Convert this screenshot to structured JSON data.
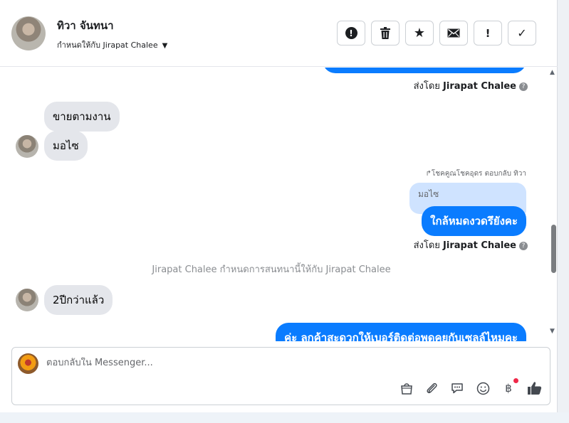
{
  "header": {
    "contact_name": "ทิวา จันทนา",
    "assigned_to": "กำหนดให้กับ Jirapat Chalee",
    "toolbar": [
      {
        "name": "spam-button",
        "icon": "exclamation-circle-icon",
        "glyph": "!"
      },
      {
        "name": "delete-button",
        "icon": "trash-icon",
        "glyph": "🗑"
      },
      {
        "name": "star-button",
        "icon": "star-icon",
        "glyph": "★"
      },
      {
        "name": "mark-unread-button",
        "icon": "envelope-icon",
        "glyph": "✉"
      },
      {
        "name": "follow-up-button",
        "icon": "exclamation-icon",
        "glyph": "!"
      },
      {
        "name": "mark-done-button",
        "icon": "check-icon",
        "glyph": "✓"
      }
    ]
  },
  "thread": {
    "sent_by_prefix": "ส่งโดย",
    "sent_by_name": "Jirapat Chalee",
    "incoming": [
      {
        "text": "ขายตามงาน"
      },
      {
        "text": "มอไซ"
      },
      {
        "text": "2ปีกว่าแล้ว"
      }
    ],
    "reply_meta": "↱โชคคูณโชคอุดร ตอบกลับ ทิวา",
    "quoted_text": "มอไซ",
    "outgoing": [
      {
        "text": "ใกล้หมดงวดรึยังคะ"
      },
      {
        "text": "ค่ะ ลูกค้าสะดวกให้เบอร์ติดต่อพูดคุยกับเซลล์ไหมคะ"
      }
    ],
    "system_message": "Jirapat Chalee กำหนดการสนทนานี้ให้กับ Jirapat Chalee"
  },
  "composer": {
    "placeholder": "ตอบกลับใน Messenger...",
    "icons": [
      {
        "name": "shop-icon",
        "glyph": "🛍"
      },
      {
        "name": "attachment-icon",
        "glyph": "📎"
      },
      {
        "name": "saved-reply-icon",
        "glyph": "💬"
      },
      {
        "name": "emoji-icon",
        "glyph": "☺"
      },
      {
        "name": "payment-icon",
        "glyph": "฿"
      },
      {
        "name": "like-icon",
        "glyph": "👍"
      }
    ]
  },
  "colors": {
    "outgoing_bubble": "#0a7cff",
    "incoming_bubble": "#e4e6eb",
    "quoted_bubble": "#cfe3ff",
    "notification_dot": "#f02849"
  }
}
